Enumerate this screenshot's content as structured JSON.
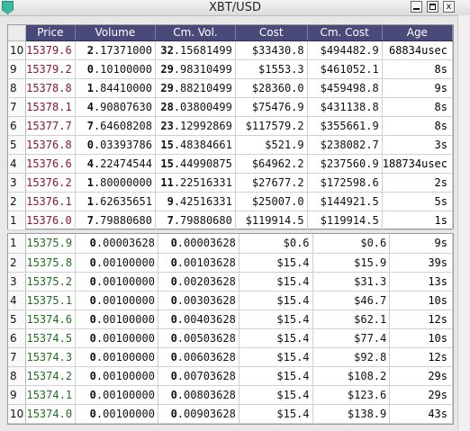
{
  "window": {
    "title": "XBT/USD",
    "min_label": "",
    "max_label": "",
    "close_label": "x"
  },
  "headers": [
    "Price",
    "Volume",
    "Cm. Vol.",
    "Cost",
    "Cm. Cost",
    "Age"
  ],
  "asks": [
    {
      "idx": "10",
      "price": "15379.6",
      "vol_int": "2",
      "vol_dec": ".17371000",
      "cm_int": "32",
      "cm_dec": ".15681499",
      "cost": "$33430.8",
      "cm_cost": "$494482.9",
      "age": "68834usec"
    },
    {
      "idx": "9",
      "price": "15379.2",
      "vol_int": "0",
      "vol_dec": ".10100000",
      "cm_int": "29",
      "cm_dec": ".98310499",
      "cost": "$1553.3",
      "cm_cost": "$461052.1",
      "age": "8s"
    },
    {
      "idx": "8",
      "price": "15378.8",
      "vol_int": "1",
      "vol_dec": ".84410000",
      "cm_int": "29",
      "cm_dec": ".88210499",
      "cost": "$28360.0",
      "cm_cost": "$459498.8",
      "age": "9s"
    },
    {
      "idx": "7",
      "price": "15378.1",
      "vol_int": "4",
      "vol_dec": ".90807630",
      "cm_int": "28",
      "cm_dec": ".03800499",
      "cost": "$75476.9",
      "cm_cost": "$431138.8",
      "age": "8s"
    },
    {
      "idx": "6",
      "price": "15377.7",
      "vol_int": "7",
      "vol_dec": ".64608208",
      "cm_int": "23",
      "cm_dec": ".12992869",
      "cost": "$117579.2",
      "cm_cost": "$355661.9",
      "age": "8s"
    },
    {
      "idx": "5",
      "price": "15376.8",
      "vol_int": "0",
      "vol_dec": ".03393786",
      "cm_int": "15",
      "cm_dec": ".48384661",
      "cost": "$521.9",
      "cm_cost": "$238082.7",
      "age": "3s"
    },
    {
      "idx": "4",
      "price": "15376.6",
      "vol_int": "4",
      "vol_dec": ".22474544",
      "cm_int": "15",
      "cm_dec": ".44990875",
      "cost": "$64962.2",
      "cm_cost": "$237560.9",
      "age": "188734usec"
    },
    {
      "idx": "3",
      "price": "15376.2",
      "vol_int": "1",
      "vol_dec": ".80000000",
      "cm_int": "11",
      "cm_dec": ".22516331",
      "cost": "$27677.2",
      "cm_cost": "$172598.6",
      "age": "2s"
    },
    {
      "idx": "2",
      "price": "15376.1",
      "vol_int": "1",
      "vol_dec": ".62635651",
      "cm_int": "9",
      "cm_dec": ".42516331",
      "cost": "$25007.0",
      "cm_cost": "$144921.5",
      "age": "5s"
    },
    {
      "idx": "1",
      "price": "15376.0",
      "vol_int": "7",
      "vol_dec": ".79880680",
      "cm_int": "7",
      "cm_dec": ".79880680",
      "cost": "$119914.5",
      "cm_cost": "$119914.5",
      "age": "1s"
    }
  ],
  "bids": [
    {
      "idx": "1",
      "price": "15375.9",
      "vol_int": "0",
      "vol_dec": ".00003628",
      "cm_int": "0",
      "cm_dec": ".00003628",
      "cost": "$0.6",
      "cm_cost": "$0.6",
      "age": "9s"
    },
    {
      "idx": "2",
      "price": "15375.8",
      "vol_int": "0",
      "vol_dec": ".00100000",
      "cm_int": "0",
      "cm_dec": ".00103628",
      "cost": "$15.4",
      "cm_cost": "$15.9",
      "age": "39s"
    },
    {
      "idx": "3",
      "price": "15375.2",
      "vol_int": "0",
      "vol_dec": ".00100000",
      "cm_int": "0",
      "cm_dec": ".00203628",
      "cost": "$15.4",
      "cm_cost": "$31.3",
      "age": "13s"
    },
    {
      "idx": "4",
      "price": "15375.1",
      "vol_int": "0",
      "vol_dec": ".00100000",
      "cm_int": "0",
      "cm_dec": ".00303628",
      "cost": "$15.4",
      "cm_cost": "$46.7",
      "age": "10s"
    },
    {
      "idx": "5",
      "price": "15374.6",
      "vol_int": "0",
      "vol_dec": ".00100000",
      "cm_int": "0",
      "cm_dec": ".00403628",
      "cost": "$15.4",
      "cm_cost": "$62.1",
      "age": "12s"
    },
    {
      "idx": "6",
      "price": "15374.5",
      "vol_int": "0",
      "vol_dec": ".00100000",
      "cm_int": "0",
      "cm_dec": ".00503628",
      "cost": "$15.4",
      "cm_cost": "$77.4",
      "age": "10s"
    },
    {
      "idx": "7",
      "price": "15374.3",
      "vol_int": "0",
      "vol_dec": ".00100000",
      "cm_int": "0",
      "cm_dec": ".00603628",
      "cost": "$15.4",
      "cm_cost": "$92.8",
      "age": "12s"
    },
    {
      "idx": "8",
      "price": "15374.2",
      "vol_int": "0",
      "vol_dec": ".00100000",
      "cm_int": "0",
      "cm_dec": ".00703628",
      "cost": "$15.4",
      "cm_cost": "$108.2",
      "age": "29s"
    },
    {
      "idx": "9",
      "price": "15374.1",
      "vol_int": "0",
      "vol_dec": ".00100000",
      "cm_int": "0",
      "cm_dec": ".00803628",
      "cost": "$15.4",
      "cm_cost": "$123.6",
      "age": "29s"
    },
    {
      "idx": "10",
      "price": "15374.0",
      "vol_int": "0",
      "vol_dec": ".00100000",
      "cm_int": "0",
      "cm_dec": ".00903628",
      "cost": "$15.4",
      "cm_cost": "$138.9",
      "age": "43s"
    }
  ],
  "colors": {
    "ask_price": "#8a1530",
    "bid_price": "#1e6e1e",
    "header_bg": "#4a4a7a"
  }
}
